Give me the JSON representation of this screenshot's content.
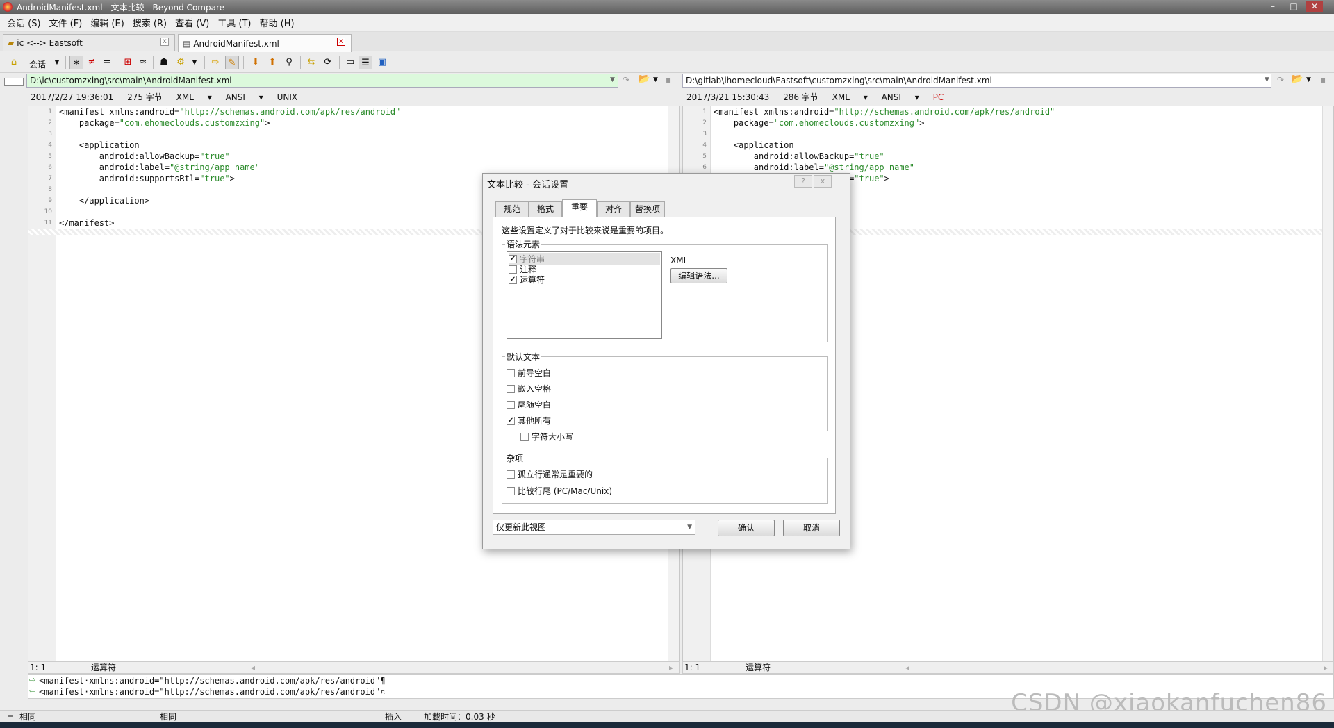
{
  "window": {
    "title": "AndroidManifest.xml - 文本比较 - Beyond Compare"
  },
  "menu": [
    "会话 (S)",
    "文件 (F)",
    "编辑 (E)",
    "搜索 (R)",
    "查看 (V)",
    "工具 (T)",
    "帮助 (H)"
  ],
  "tabs": [
    {
      "label": "ic <--> Eastsoft"
    },
    {
      "label": "AndroidManifest.xml"
    }
  ],
  "toolbar": {
    "session_label": "会话"
  },
  "left": {
    "path": "D:\\ic\\customzxing\\src\\main\\AndroidManifest.xml",
    "date": "2017/2/27 19:36:01",
    "size": "275 字节",
    "format": "XML",
    "encoding": "ANSI",
    "lineend": "UNIX",
    "status_pos": "1: 1",
    "status_label": "运算符"
  },
  "right": {
    "path": "D:\\gitlab\\ihomecloud\\Eastsoft\\customzxing\\src\\main\\AndroidManifest.xml",
    "date": "2017/3/21 15:30:43",
    "size": "286 字节",
    "format": "XML",
    "encoding": "ANSI",
    "lineend": "PC",
    "status_pos": "1: 1",
    "status_label": "运算符"
  },
  "code_lines": [
    {
      "n": "1",
      "a": "<manifest xmlns:android=",
      "s": "\"http://schemas.android.com/apk/res/android\"",
      "b": ""
    },
    {
      "n": "2",
      "a": "    package=",
      "s": "\"com.ehomeclouds.customzxing\"",
      "b": ">"
    },
    {
      "n": "3",
      "a": "",
      "s": "",
      "b": ""
    },
    {
      "n": "4",
      "a": "    <application",
      "s": "",
      "b": ""
    },
    {
      "n": "5",
      "a": "        android:allowBackup=",
      "s": "\"true\"",
      "b": ""
    },
    {
      "n": "6",
      "a": "        android:label=",
      "s": "\"@string/app_name\"",
      "b": ""
    },
    {
      "n": "7",
      "a": "        android:supportsRtl=",
      "s": "\"true\"",
      "b": ">"
    },
    {
      "n": "8",
      "a": "",
      "s": "",
      "b": ""
    },
    {
      "n": "9",
      "a": "    </application>",
      "s": "",
      "b": ""
    },
    {
      "n": "10",
      "a": "",
      "s": "",
      "b": ""
    },
    {
      "n": "11",
      "a": "</manifest>",
      "s": "",
      "b": ""
    }
  ],
  "compare": {
    "line1": "<manifest·xmlns:android=\"http://schemas.android.com/apk/res/android\"¶",
    "line2": "<manifest·xmlns:android=\"http://schemas.android.com/apk/res/android\"¤"
  },
  "bottom": {
    "left": "相同",
    "mid": "相同",
    "mode": "插入",
    "load_time": "加載时间：0.03 秒"
  },
  "watermark": "CSDN @xiaokanfuchen86",
  "dialog": {
    "title": "文本比较 - 会话设置",
    "help": "?",
    "close": "x",
    "tabs": [
      "规范",
      "格式",
      "重要",
      "对齐",
      "替换项"
    ],
    "description": "这些设置定义了对于比较来说是重要的项目。",
    "grammar_group": "语法元素",
    "grammar_items": [
      {
        "label": "字符串",
        "checked": true
      },
      {
        "label": "注释",
        "checked": false
      },
      {
        "label": "运算符",
        "checked": true
      }
    ],
    "grammar_type": "XML",
    "edit_grammar": "编辑语法...",
    "default_group": "默认文本",
    "default_items": [
      {
        "label": "前导空白",
        "checked": false
      },
      {
        "label": "嵌入空格",
        "checked": false
      },
      {
        "label": "尾随空白",
        "checked": false
      },
      {
        "label": "其他所有",
        "checked": true
      }
    ],
    "case_item": {
      "label": "字符大小写",
      "checked": false
    },
    "misc_group": "杂项",
    "misc_items": [
      {
        "label": "孤立行通常是重要的",
        "checked": false
      },
      {
        "label": "比较行尾 (PC/Mac/Unix)",
        "checked": false
      }
    ],
    "scope_select": "仅更新此视图",
    "ok": "确认",
    "cancel": "取消"
  }
}
